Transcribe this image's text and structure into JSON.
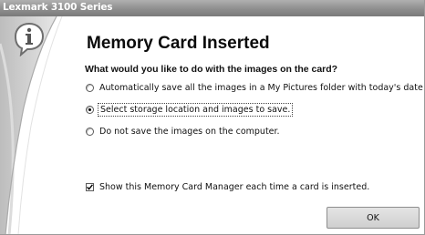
{
  "window": {
    "title": "Lexmark 3100 Series"
  },
  "dialog": {
    "heading": "Memory Card Inserted",
    "question": "What would you like to do with the images on the card?",
    "options": [
      {
        "label": "Automatically save all the images in a My Pictures folder with today's date",
        "selected": false
      },
      {
        "label": "Select storage location and images to save.",
        "selected": true
      },
      {
        "label": "Do not save the images on the computer.",
        "selected": false
      }
    ],
    "show_manager": {
      "label": "Show this Memory Card Manager each time a card is inserted.",
      "checked": true
    },
    "ok_label": "OK"
  },
  "icons": {
    "info": "info-icon",
    "check": "checkmark-icon"
  },
  "colors": {
    "titlebar": "#8e8e8e",
    "side_panel": "#c8c8c8",
    "icon_accent": "#6e6e6e"
  }
}
